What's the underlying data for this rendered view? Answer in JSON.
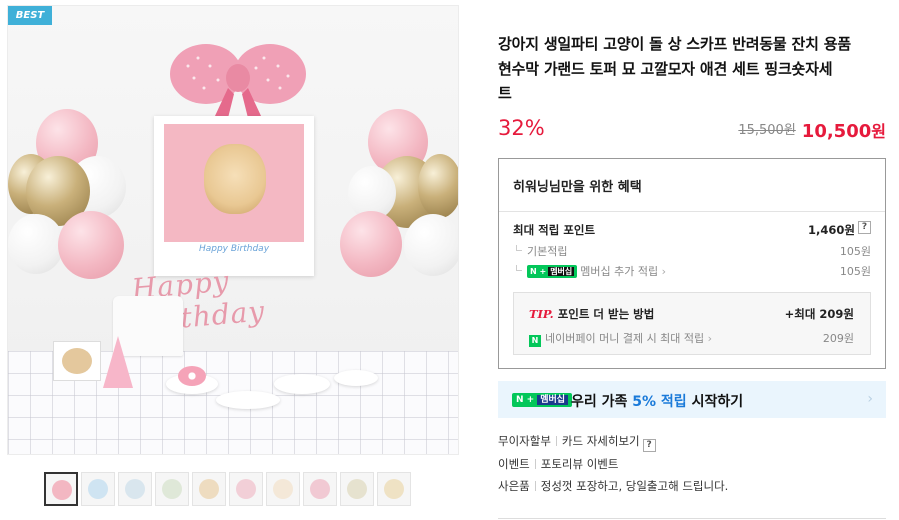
{
  "gallery": {
    "badge": "BEST",
    "poster_text": "Happy Birthday",
    "garland_text": "Happy Birthday",
    "thumbnail_count": 10,
    "selected_thumbnail": 1
  },
  "product": {
    "title_line1": "강아지 생일파티 고양이 돌 상 스카프 반려동물 잔치 용품",
    "title_line2": "현수막 가랜드 토퍼 묘 고깔모자 애견 세트 핑크숏자세",
    "title_line3": "트",
    "discount": "32%",
    "original_price": "15,500원",
    "sale_price": "10,500",
    "sale_unit": "원"
  },
  "benefits": {
    "title": "히워닝님만을 위한 혜택",
    "max_points_label": "최대 적립 포인트",
    "max_points_value": "1,460원",
    "help_icon_text": "?",
    "basic_label": "기본적립",
    "basic_value": "105원",
    "membership_badge_n": "N +",
    "membership_badge_mem": "멤버십",
    "membership_label": "멤버십 추가 적립",
    "membership_value": "105원",
    "tip_prefix": "TIP.",
    "tip_title": "포인트 더 받는 방법",
    "tip_max": "+최대 209원",
    "tip_n_icon": "N",
    "tip_sub_label": "네이버페이 머니 결제 시 최대 적립",
    "tip_sub_value": "209원",
    "chevron": "›"
  },
  "promo": {
    "badge_n": "N +",
    "badge_mem": "멤버십",
    "text_before": "우리 가족",
    "text_highlight": "5% 적립",
    "text_after": "시작하기",
    "chevron": "›"
  },
  "extras": {
    "installment": "무이자할부",
    "card_detail": "카드 자세히보기",
    "help": "?",
    "event_label": "이벤트",
    "event_value": "포토리뷰 이벤트",
    "gift_label": "사은품",
    "gift_value": "정성껏 포장하고, 당일출고해 드립니다."
  },
  "colors": {
    "accent_red": "#e61a3c",
    "naver_green": "#03c75a",
    "promo_blue": "#1a7ad9",
    "best_badge": "#3fb0d8"
  }
}
